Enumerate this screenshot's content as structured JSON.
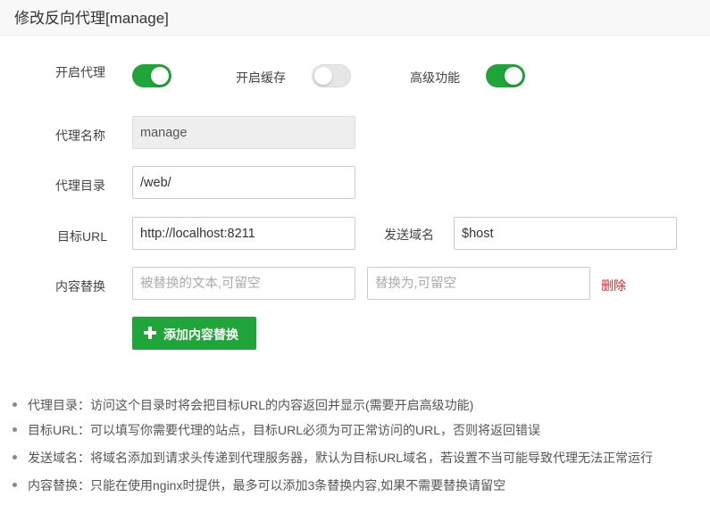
{
  "dialog": {
    "title": "修改反向代理[manage]"
  },
  "toggles": {
    "proxy": {
      "label": "开启代理",
      "on": true
    },
    "cache": {
      "label": "开启缓存",
      "on": false
    },
    "advanced": {
      "label": "高级功能",
      "on": true
    }
  },
  "fields": {
    "proxy_name": {
      "label": "代理名称",
      "value": "manage"
    },
    "proxy_dir": {
      "label": "代理目录",
      "value": "/web/"
    },
    "target_url": {
      "label": "目标URL",
      "value": "http://localhost:8211"
    },
    "send_domain": {
      "label": "发送域名",
      "value": "$host"
    },
    "replace": {
      "label": "内容替换",
      "from_placeholder": "被替换的文本,可留空",
      "to_placeholder": "替换为,可留空",
      "delete_label": "删除"
    }
  },
  "add_button": {
    "label": "添加内容替换",
    "icon": "plus-icon"
  },
  "tips": [
    "代理目录：访问这个目录时将会把目标URL的内容返回并显示(需要开启高级功能)",
    "目标URL：可以填写你需要代理的站点，目标URL必须为可正常访问的URL，否则将返回错误",
    "发送域名：将域名添加到请求头传递到代理服务器，默认为目标URL域名，若设置不当可能导致代理无法正常运行",
    "内容替换：只能在使用nginx时提供，最多可以添加3条替换内容,如果不需要替换请留空"
  ],
  "colors": {
    "accent": "#20a53a",
    "danger": "#e0262a"
  }
}
